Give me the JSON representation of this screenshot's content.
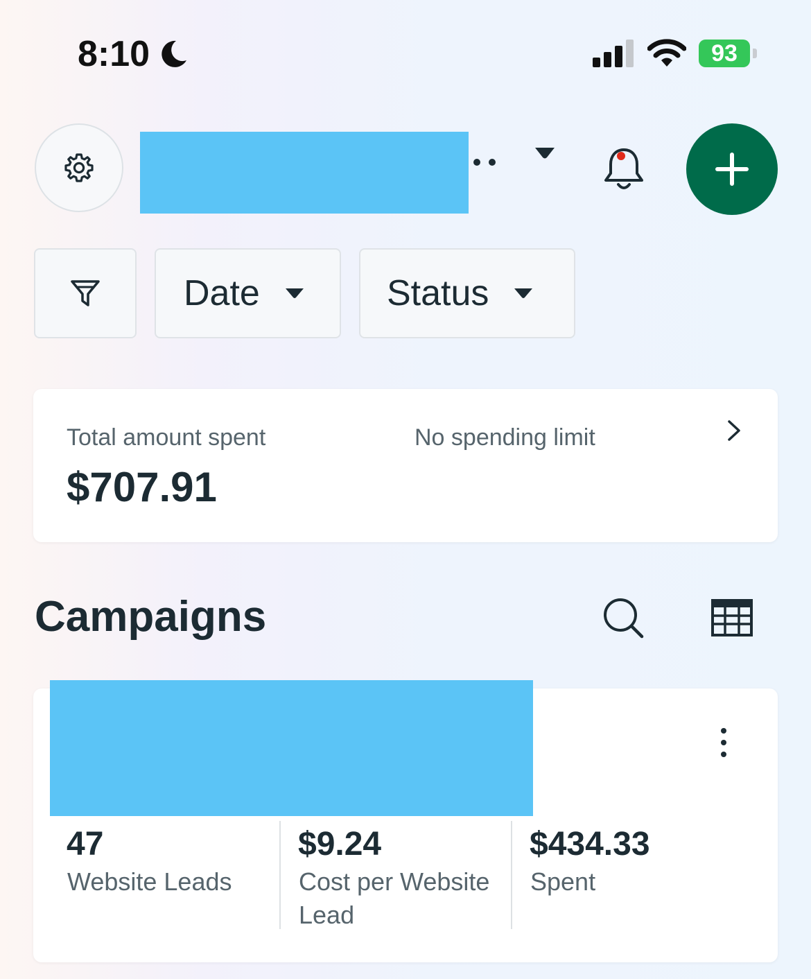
{
  "status_bar": {
    "time": "8:10",
    "battery": "93",
    "icons": [
      "moon-icon",
      "signal-icon",
      "wifi-icon",
      "battery-icon"
    ]
  },
  "header": {
    "icons": [
      "gear-icon",
      "more-dots-icon",
      "caret-down-icon",
      "bell-icon",
      "plus-icon"
    ],
    "accent_color": "#006b4a",
    "notification_dot_color": "#e02a1b"
  },
  "filters": {
    "icon": "filter-icon",
    "date_label": "Date",
    "status_label": "Status"
  },
  "spend_summary": {
    "label": "Total amount spent",
    "value": "$707.91",
    "limit_text": "No spending limit"
  },
  "campaigns": {
    "title": "Campaigns",
    "icons": [
      "search-icon",
      "table-icon"
    ],
    "items": [
      {
        "metrics": [
          {
            "value": "47",
            "label": "Website Leads"
          },
          {
            "value": "$9.24",
            "label": "Cost per Website Lead"
          },
          {
            "value": "$434.33",
            "label": "Spent"
          }
        ]
      }
    ]
  }
}
